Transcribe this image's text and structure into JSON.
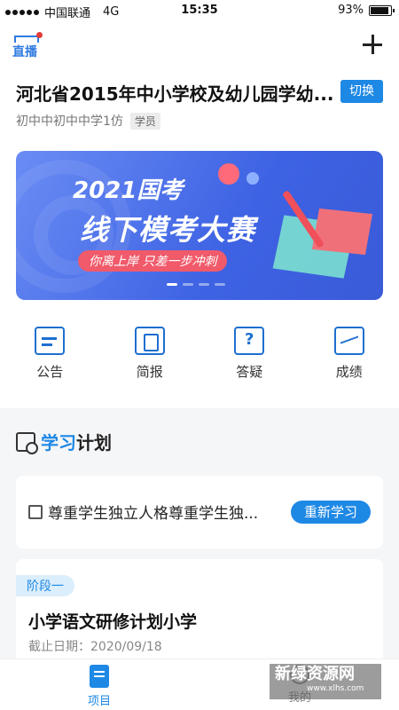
{
  "status_bar": {
    "carrier": "中国联通",
    "network": "4G",
    "time": "15:35",
    "battery": "93%",
    "battery_level": 0.93
  },
  "header": {
    "live_label": "直播",
    "school_title": "河北省2015年中小学校及幼儿园学幼...",
    "switch_label": "切换",
    "user_name": "初中中初中中学1仿",
    "role_badge": "学员"
  },
  "banner": {
    "line1": "2021国考",
    "line2": "线下模考大赛",
    "slogan": "你离上岸 只差一步冲刺",
    "active_index": 0,
    "total_slides": 4
  },
  "quick_links": [
    {
      "label": "公告",
      "icon": "announcement-icon"
    },
    {
      "label": "简报",
      "icon": "briefing-icon"
    },
    {
      "label": "答疑",
      "icon": "qa-icon"
    },
    {
      "label": "成绩",
      "icon": "score-icon"
    }
  ],
  "study_plan": {
    "title_highlight": "学习",
    "title_rest": "计划",
    "current_item": "尊重学生独立人格尊重学生独...",
    "relearn_label": "重新学习",
    "stage_label": "阶段一",
    "plan_name": "小学语文研修计划小学",
    "deadline": "截止日期：2020/09/18"
  },
  "tabs": {
    "project": "项目",
    "mine": "我的"
  },
  "watermark": {
    "text": "新绿资源网",
    "url": "www.xlhs.com"
  }
}
